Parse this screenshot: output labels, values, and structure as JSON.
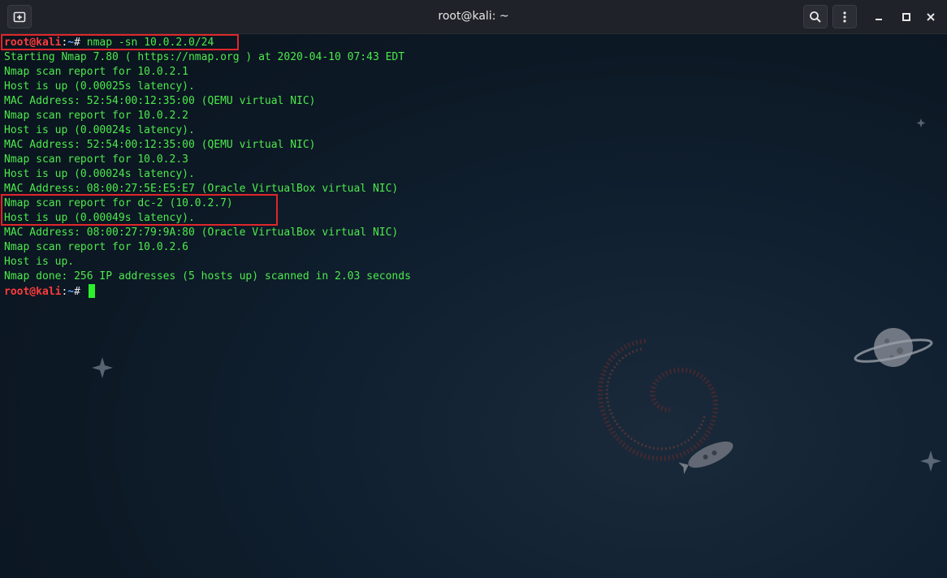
{
  "window": {
    "title": "root@kali: ~"
  },
  "titlebar": {
    "new_tab_icon": "new-tab-icon",
    "search_icon": "search-icon",
    "menu_icon": "kebab-menu-icon",
    "minimize_icon": "minimize-icon",
    "maximize_icon": "maximize-icon",
    "close_icon": "close-icon"
  },
  "prompt": {
    "user": "root@kali",
    "sep": ":",
    "path": "~",
    "symbol": "# "
  },
  "command": "nmap -sn 10.0.2.0/24",
  "output": [
    "Starting Nmap 7.80 ( https://nmap.org ) at 2020-04-10 07:43 EDT",
    "Nmap scan report for 10.0.2.1",
    "Host is up (0.00025s latency).",
    "MAC Address: 52:54:00:12:35:00 (QEMU virtual NIC)",
    "Nmap scan report for 10.0.2.2",
    "Host is up (0.00024s latency).",
    "MAC Address: 52:54:00:12:35:00 (QEMU virtual NIC)",
    "Nmap scan report for 10.0.2.3",
    "Host is up (0.00024s latency).",
    "MAC Address: 08:00:27:5E:E5:E7 (Oracle VirtualBox virtual NIC)",
    "Nmap scan report for dc-2 (10.0.2.7)",
    "Host is up (0.00049s latency).",
    "MAC Address: 08:00:27:79:9A:80 (Oracle VirtualBox virtual NIC)",
    "Nmap scan report for 10.0.2.6",
    "Host is up.",
    "Nmap done: 256 IP addresses (5 hosts up) scanned in 2.03 seconds"
  ],
  "colors": {
    "output_green": "#4de94c",
    "prompt_red": "#ff3b3b",
    "path_blue": "#5aa0ff",
    "highlight_red": "#e0262a"
  }
}
